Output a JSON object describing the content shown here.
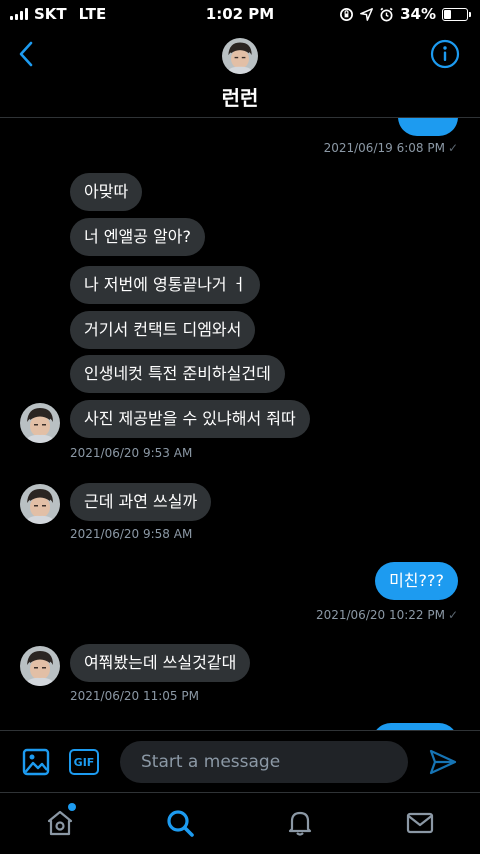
{
  "status_bar": {
    "carrier": "SKT",
    "network": "LTE",
    "time": "1:02 PM",
    "battery": "34%",
    "battery_level": 0.34
  },
  "header": {
    "name": "런런",
    "back_icon": "chevron-left-icon",
    "info_icon": "info-icon",
    "accent_color": "#1d9bf0"
  },
  "messages": {
    "out0_time": "2021/06/19 6:08 PM",
    "in_group1": [
      "아맞따",
      "너 엔앨공 알아?",
      "나 저번에 영통끝나거 ㅓ",
      "거기서 컨택트 디엠와서",
      "인생네컷 특전 준비하실건데",
      "사진 제공받을 수 있냐해서 줘따"
    ],
    "in_group1_time": "2021/06/20 9:53 AM",
    "in_group2": [
      "근데 과연 쓰실까"
    ],
    "in_group2_time": "2021/06/20 9:58 AM",
    "out1": "미친???",
    "out1_time": "2021/06/20 10:22 PM",
    "in_group3": [
      "여쭤봤는데 쓰실것같대"
    ],
    "in_group3_time": "2021/06/20 11:05 PM"
  },
  "composer": {
    "placeholder": "Start a message",
    "gif_label": "GIF",
    "image_icon": "image-icon",
    "send_icon": "send-icon"
  },
  "tabbar": {
    "items": [
      "home-icon",
      "search-icon",
      "bell-icon",
      "mail-icon"
    ],
    "active": "search-icon"
  }
}
